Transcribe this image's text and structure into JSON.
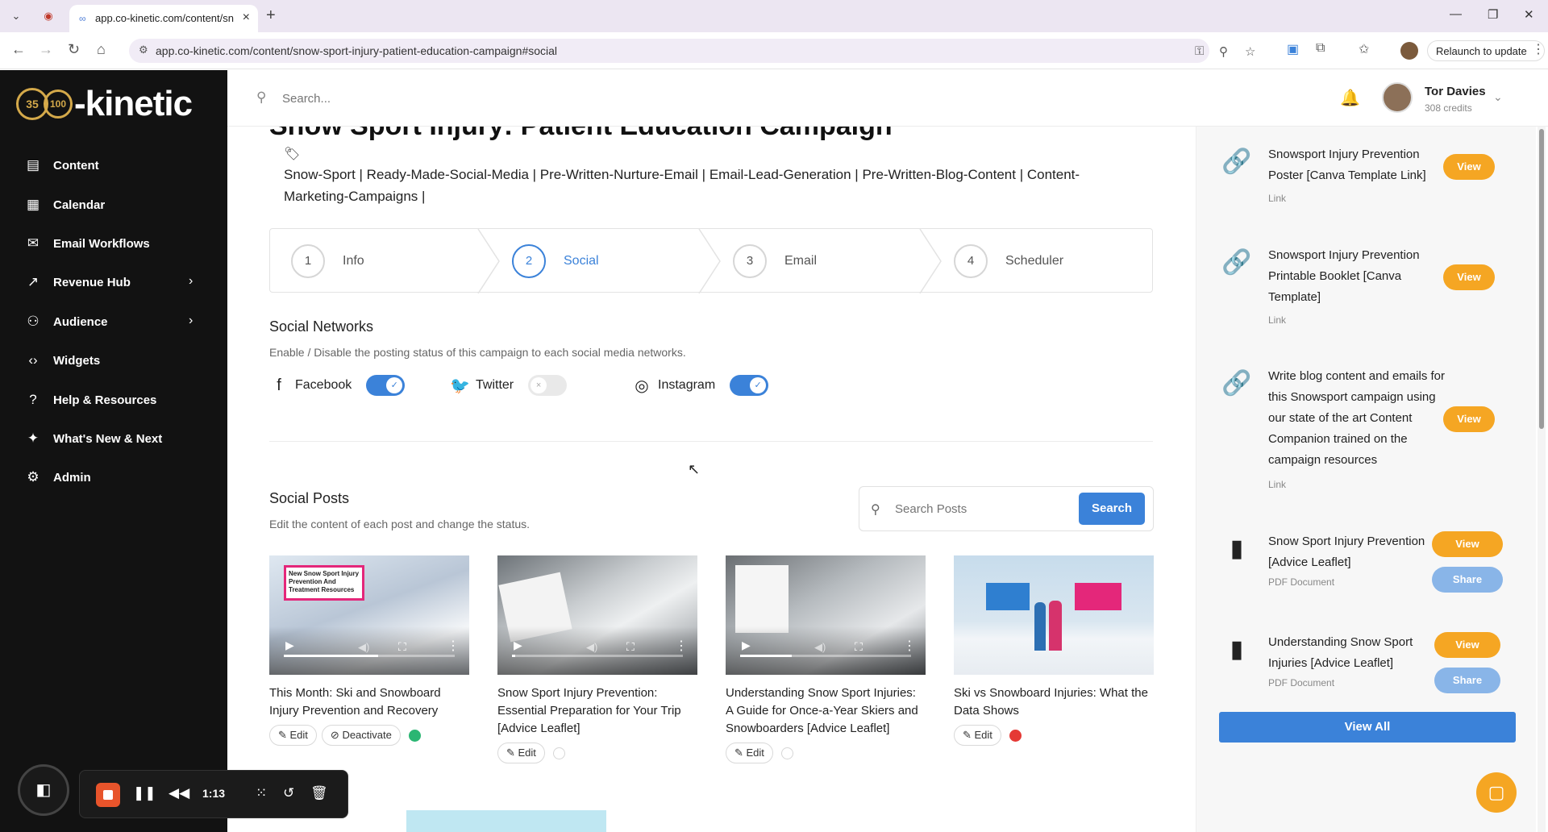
{
  "browser": {
    "tab_title": "app.co-kinetic.com/content/sn",
    "url": "app.co-kinetic.com/content/snow-sport-injury-patient-education-campaign#social",
    "relaunch_label": "Relaunch to update"
  },
  "sidebar": {
    "logo_text": "-kinetic",
    "logo_badge_1": "35",
    "logo_badge_2": "100",
    "items": [
      {
        "label": "Content",
        "icon": "document-icon"
      },
      {
        "label": "Calendar",
        "icon": "calendar-icon"
      },
      {
        "label": "Email Workflows",
        "icon": "mail-icon"
      },
      {
        "label": "Revenue Hub",
        "icon": "trend-icon"
      },
      {
        "label": "Audience",
        "icon": "users-icon"
      },
      {
        "label": "Widgets",
        "icon": "code-icon"
      },
      {
        "label": "Help & Resources",
        "icon": "help-icon"
      },
      {
        "label": "What's New & Next",
        "icon": "sparkle-icon"
      },
      {
        "label": "Admin",
        "icon": "gear-icon"
      }
    ]
  },
  "topbar": {
    "search_placeholder": "Search...",
    "user_name": "Tor Davies",
    "user_credits": "308 credits"
  },
  "main": {
    "title": "Snow Sport Injury: Patient Education Campaign",
    "tags": "Snow-Sport | Ready-Made-Social-Media | Pre-Written-Nurture-Email | Email-Lead-Generation | Pre-Written-Blog-Content | Content-Marketing-Campaigns |",
    "steps": [
      {
        "num": "1",
        "label": "Info"
      },
      {
        "num": "2",
        "label": "Social"
      },
      {
        "num": "3",
        "label": "Email"
      },
      {
        "num": "4",
        "label": "Scheduler"
      }
    ],
    "social_networks_title": "Social Networks",
    "social_networks_desc": "Enable / Disable the posting status of this campaign to each social media networks.",
    "networks": [
      {
        "name": "Facebook",
        "enabled": true
      },
      {
        "name": "Twitter",
        "enabled": false
      },
      {
        "name": "Instagram",
        "enabled": true
      }
    ],
    "social_posts_title": "Social Posts",
    "social_posts_desc": "Edit the content of each post and change the status.",
    "search_posts_placeholder": "Search Posts",
    "search_button": "Search",
    "edit_label": "Edit",
    "deactivate_label": "Deactivate",
    "thumb_banner": "New Snow Sport Injury Prevention And Treatment Resources",
    "posts": [
      {
        "title": "This Month: Ski and Snowboard Injury Prevention and Recovery",
        "status": "active",
        "progress": 0.55
      },
      {
        "title": "Snow Sport Injury Prevention: Essential Preparation for Your Trip [Advice Leaflet]",
        "status": "inactive",
        "progress": 0.02
      },
      {
        "title": "Understanding Snow Sport Injuries: A Guide for Once-a-Year Skiers and Snowboarders [Advice Leaflet]",
        "status": "inactive",
        "progress": 0.3
      },
      {
        "title": "Ski vs Snowboard Injuries: What the Data Shows",
        "status": "error",
        "progress": 0
      }
    ]
  },
  "resources": {
    "view_label": "View",
    "share_label": "Share",
    "view_all": "View All",
    "items": [
      {
        "title": "Snowsport Injury Prevention Poster [Canva Template Link]",
        "kind": "Link"
      },
      {
        "title": "Snowsport Injury Prevention Printable Booklet [Canva Template]",
        "kind": "Link"
      },
      {
        "title": "Write blog content and emails for this Snowsport campaign using our state of the art Content Companion trained on the campaign resources",
        "kind": "Link"
      },
      {
        "title": "Snow Sport Injury Prevention [Advice Leaflet]",
        "kind": "PDF Document"
      },
      {
        "title": "Understanding Snow Sport Injuries [Advice Leaflet]",
        "kind": "PDF Document"
      }
    ]
  },
  "recorder": {
    "time": "1:13"
  },
  "colors": {
    "accent": "#3b82d9",
    "view_button": "#f5a623",
    "sidebar_bg": "#121212"
  }
}
